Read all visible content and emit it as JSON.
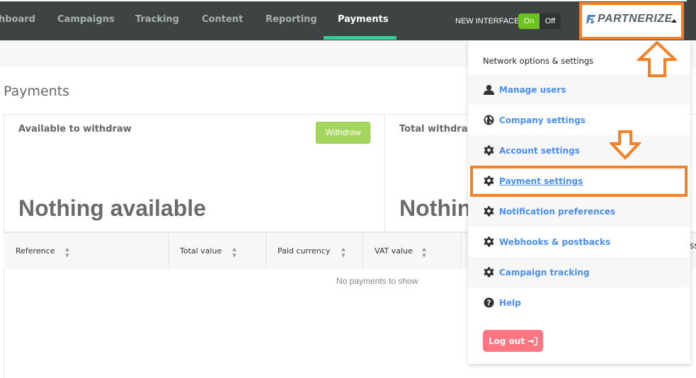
{
  "nav": {
    "items": [
      {
        "label": "hboard",
        "active": false
      },
      {
        "label": "Campaigns",
        "active": false
      },
      {
        "label": "Tracking",
        "active": false
      },
      {
        "label": "Content",
        "active": false
      },
      {
        "label": "Reporting",
        "active": false
      },
      {
        "label": "Payments",
        "active": true
      }
    ],
    "new_interface_label": "NEW INTERFACE",
    "toggle": {
      "on_label": "On",
      "off_label": "Off",
      "state": "On"
    },
    "brand": "PARTNERIZE"
  },
  "page": {
    "title": "Payments",
    "cards": [
      {
        "label": "Available to withdraw",
        "value": "Nothing available",
        "button": "Withdraw"
      },
      {
        "label": "Total withdraw",
        "value": "Nothin"
      }
    ],
    "table": {
      "columns": [
        "Reference",
        "Total value",
        "Paid currency",
        "VAT value"
      ],
      "partial_column": "ss",
      "empty_message": "No payments to show"
    }
  },
  "menu": {
    "heading": "Network options & settings",
    "items": [
      {
        "label": "Manage users",
        "icon": "user-icon"
      },
      {
        "label": "Company settings",
        "icon": "globe-icon"
      },
      {
        "label": "Account settings",
        "icon": "gear-icon"
      },
      {
        "label": "Payment settings",
        "icon": "gear-icon",
        "highlighted": true
      },
      {
        "label": "Notification preferences",
        "icon": "gear-icon"
      },
      {
        "label": "Webhooks & postbacks",
        "icon": "gear-icon"
      },
      {
        "label": "Campaign tracking",
        "icon": "gear-icon"
      },
      {
        "label": "Help",
        "icon": "help-icon"
      }
    ],
    "logout_label": "Log out"
  },
  "colors": {
    "accent_green": "#2fd39a",
    "annotation_orange": "#f48126",
    "link_blue": "#4a8ff0",
    "logout_red": "#ff7582",
    "withdraw_green": "#a4d65e"
  }
}
